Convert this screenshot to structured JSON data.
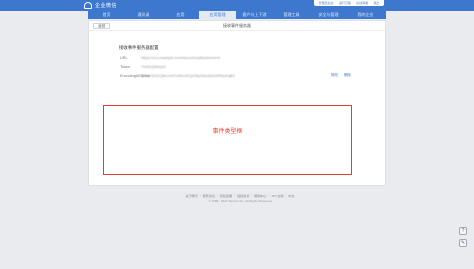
{
  "header": {
    "logo_text": "企业微信",
    "user_links": [
      "管理员后台",
      "进行日程",
      "在线客服",
      "退出"
    ]
  },
  "nav": {
    "items": [
      "首页",
      "通讯录",
      "应用",
      "应用管理",
      "客户与上下游",
      "管理工具",
      "安全与管理",
      "我的企业"
    ],
    "active_index": 3
  },
  "page": {
    "back_label": "返回",
    "title": "接收事件服务器",
    "config_title": "接收事件服务器配置",
    "fields": [
      {
        "label": "URL",
        "value": "https://xxx.example.com/wecom/callback/event"
      },
      {
        "label": "Token",
        "value": "7mSxQ4bKp2t"
      },
      {
        "label": "EncodingAESKey",
        "value": "g3k9Yb2ZrQ8cLm4TvW1xN7pH5aJ0eU6sD2fR9oKqB3"
      }
    ],
    "actions": {
      "edit": "修改",
      "delete": "删除"
    },
    "event_area_label": "事件类型框"
  },
  "footer": {
    "links": [
      "关于腾讯",
      "服务协议",
      "隐私政策",
      "侵权投诉",
      "帮助中心",
      "API 文档",
      "中文"
    ],
    "copyright": "© 1998 - 2024 Tencent Inc. All Rights Reserved"
  },
  "side_icons": [
    "help-icon",
    "feedback-icon"
  ],
  "colors": {
    "brand": "#3d78ce",
    "highlight": "#e33b2f",
    "page_bg": "#e9ebef"
  }
}
